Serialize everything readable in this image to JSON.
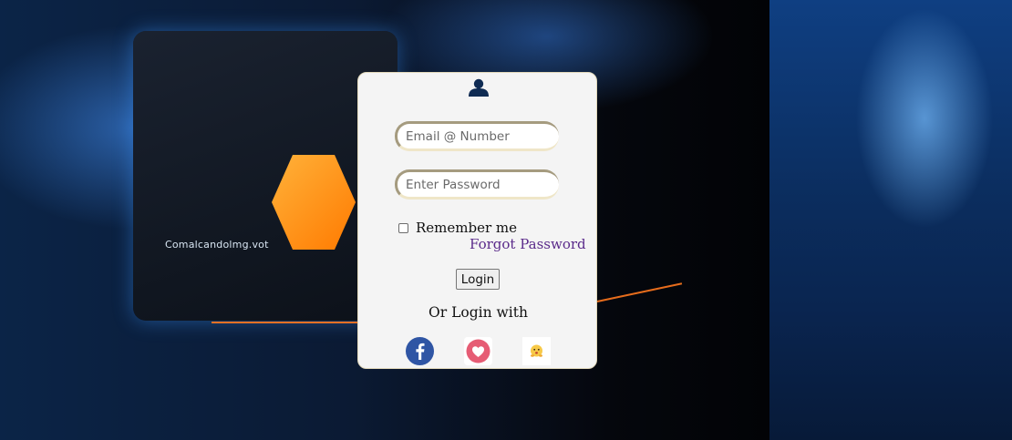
{
  "background": {
    "card_caption": "Comalcandolmg.vot"
  },
  "login_card": {
    "email_placeholder": "Email @ Number",
    "password_placeholder": "Enter Password",
    "remember_label": "Remember me",
    "remember_checked": false,
    "forgot_label": "Forgot Password",
    "login_button_label": "Login",
    "or_login_with": "Or Login with",
    "social_providers": [
      {
        "name": "facebook-icon"
      },
      {
        "name": "heart-icon"
      },
      {
        "name": "emoji-icon"
      }
    ]
  },
  "colors": {
    "card_bg": "#f4f4f4",
    "forgot_link": "#5a2a8a",
    "user_icon": "#0f2b53",
    "facebook": "#2f55a4",
    "heart": "#e65c74"
  }
}
